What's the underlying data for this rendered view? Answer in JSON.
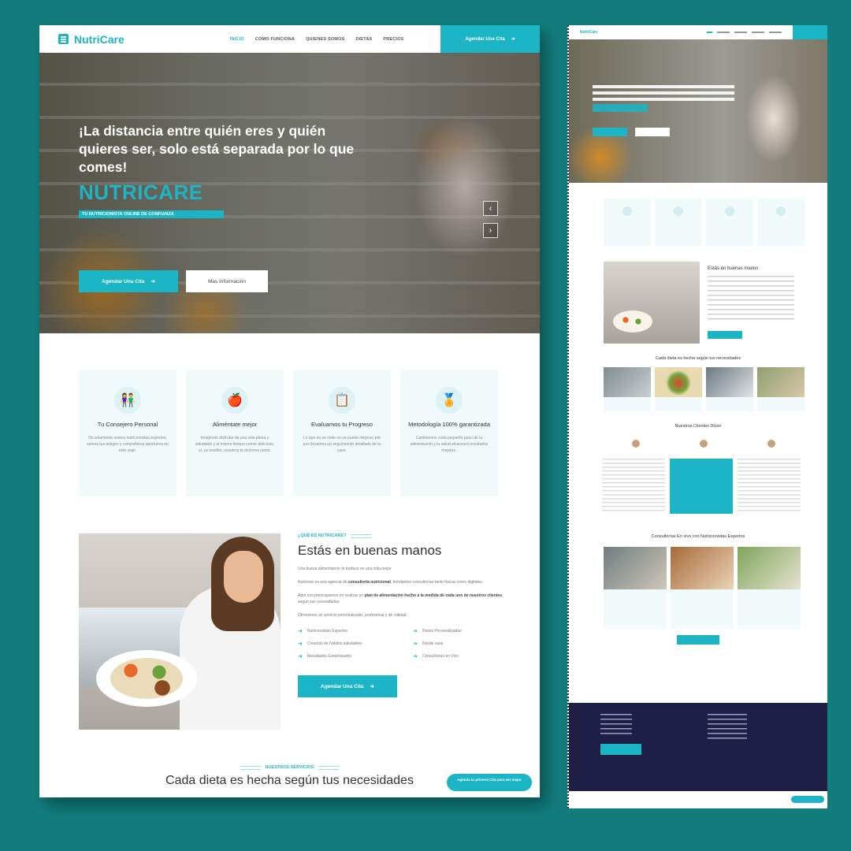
{
  "nav": {
    "logo": "NutriCare",
    "menu": [
      "INICIO",
      "COMO FUNCIONA",
      "QUIENES SOMOS",
      "DIETAS",
      "PRECIOS"
    ],
    "cta": "Agendar Una Cita"
  },
  "hero": {
    "title": "¡La distancia entre quién eres y quién quieres ser, solo está separada por lo que comes!",
    "brand": "NUTRICARE",
    "subtitle": "TU NUTRICIONISTA ONLINE DE CONFIANZA",
    "primary_button": "Agendar Una Cita",
    "secondary_button": "Mas Información"
  },
  "features": [
    {
      "icon": "advisor-icon",
      "title": "Tu Consejero Personal",
      "desc": "No solamente somos nutricionistas expertos, somos tus amigos y compañeros oportunos en este viaje."
    },
    {
      "icon": "apple-icon",
      "title": "Aliméntate mejor",
      "desc": "Imagínate disfrutar de una vida plena y saludable y al mismo tiempo comer delicioso, sí, es posible, nosotros te decimos como."
    },
    {
      "icon": "clipboard-icon",
      "title": "Evaluamos tu Progreso",
      "desc": "Lo que no se mide no se puede mejorar, por eso llevamos un seguimiento detallado de tu caso."
    },
    {
      "icon": "medal-icon",
      "title": "Metodología 100% garantizada",
      "desc": "Cambiamos cada pequeño paso de tu alimentación y tu salud alcanzará resultados mejores."
    }
  ],
  "about": {
    "eyebrow": "¿QUÉ ES NUTRICARE?",
    "title": "Estás en buenas manos",
    "p1": "Una buena alimentación te traduce en una vida mejor.",
    "p2_pre": "Nutricare es una agencia de ",
    "p2_bold": "consultoría nutricional",
    "p2_post": ", brindamos consultorías tanto físicas como digitales.",
    "p3_pre": "Aquí nos preocupamos en realizar un ",
    "p3_bold": "plan de alimentación hecho a la medida de cada uno de nuestros clientes",
    "p3_post": ", según sus necesidades.",
    "p4": "Ofrecemos un servicio personalizado, profesional y de calidad.",
    "checks": [
      "Nutricionistas Expertos",
      "Dietas Personalizadas",
      "Creación de hábitos saludables",
      "Desde casa",
      "Resultados Garantizados",
      "Consultorías en Vivo"
    ],
    "button": "Agendar Una Cita"
  },
  "services": {
    "eyebrow": "NUESTROS SERVICIOS",
    "title": "Cada dieta es hecha según tus necesidades",
    "float_cta": "Agenda tu primera Cita para ser mejor"
  },
  "mini": {
    "about_title": "Estás en buenas manos",
    "diets_title": "Cada dieta es hecha según tus necesidades",
    "clients_title": "Nuestros Clientes Dicen",
    "live_title": "Consultorías En vivo con Nutricionistas Expertos"
  },
  "colors": {
    "accent": "#1bb5c5",
    "background": "#127c7c",
    "footer": "#1d1f45"
  }
}
